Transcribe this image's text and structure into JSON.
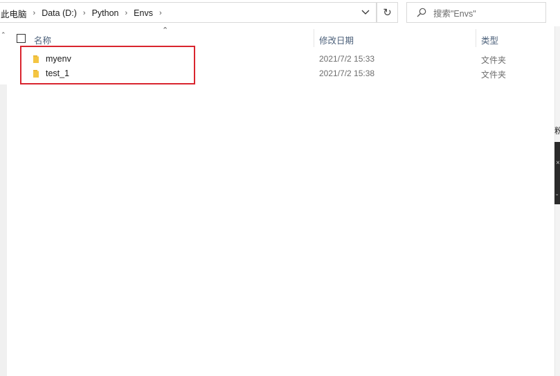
{
  "breadcrumb": {
    "items": [
      "此电脑",
      "Data (D:)",
      "Python",
      "Envs"
    ]
  },
  "search": {
    "placeholder": "搜索\"Envs\""
  },
  "columns": {
    "name": "名称",
    "date_modified": "修改日期",
    "type": "类型"
  },
  "files": [
    {
      "name": "myenv",
      "date_modified": "2021/7/2 15:33",
      "type": "文件夹"
    },
    {
      "name": "test_1",
      "date_modified": "2021/7/2 15:38",
      "type": "文件夹"
    }
  ],
  "right_edge_char": "粉",
  "colors": {
    "folder": "#f4c542",
    "highlight": "#d9242e",
    "header_text": "#4c607a"
  },
  "icons": {
    "chevron": "chevron-right-icon",
    "dropdown": "chevron-down-icon",
    "refresh": "refresh-icon",
    "search": "search-icon",
    "folder": "folder-icon"
  }
}
